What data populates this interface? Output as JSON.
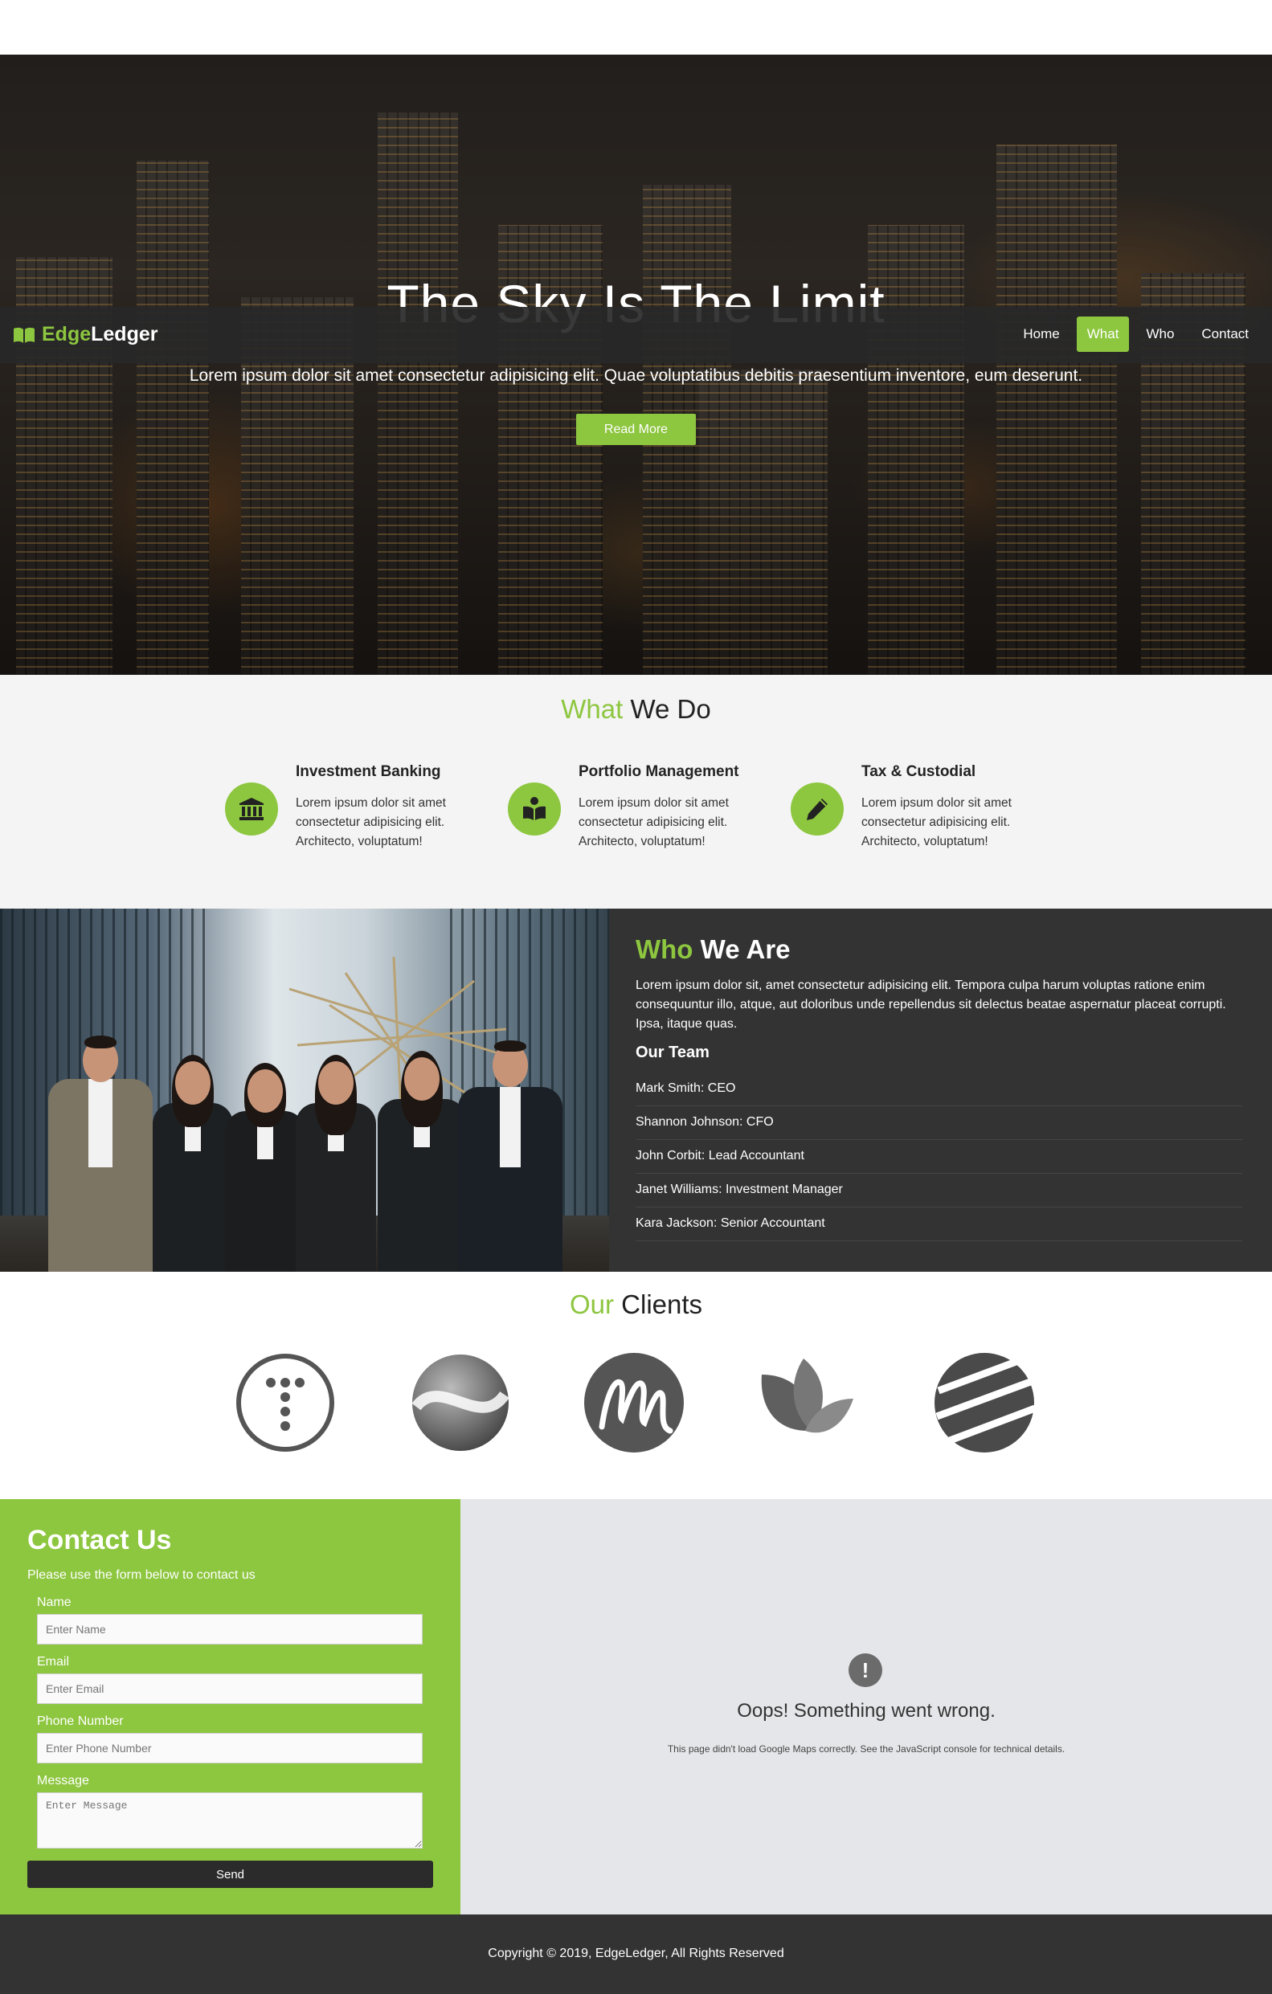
{
  "brand": {
    "part1": "Edge",
    "part2": "Ledger"
  },
  "nav": {
    "items": [
      {
        "label": "Home",
        "active": false
      },
      {
        "label": "What",
        "active": true
      },
      {
        "label": "Who",
        "active": false
      },
      {
        "label": "Contact",
        "active": false
      }
    ]
  },
  "hero": {
    "title": "The Sky Is The Limit",
    "subtitle": "Lorem ipsum dolor sit amet consectetur adipisicing elit. Quae voluptatibus debitis praesentium inventore, eum deserunt.",
    "button": "Read More"
  },
  "what": {
    "title_accent": "What",
    "title_rest": "We Do",
    "services": [
      {
        "icon": "bank-icon",
        "title": "Investment Banking",
        "text": "Lorem ipsum dolor sit amet consectetur adipisicing elit. Architecto, voluptatum!"
      },
      {
        "icon": "book-reader-icon",
        "title": "Portfolio Management",
        "text": "Lorem ipsum dolor sit amet consectetur adipisicing elit. Architecto, voluptatum!"
      },
      {
        "icon": "pencil-icon",
        "title": "Tax & Custodial",
        "text": "Lorem ipsum dolor sit amet consectetur adipisicing elit. Architecto, voluptatum!"
      }
    ]
  },
  "who": {
    "title_accent": "Who",
    "title_rest": "We Are",
    "text": "Lorem ipsum dolor sit, amet consectetur adipisicing elit. Tempora culpa harum voluptas ratione enim consequuntur illo, atque, aut doloribus unde repellendus sit delectus beatae aspernatur placeat corrupti. Ipsa, itaque quas.",
    "team_heading": "Our Team",
    "team": [
      "Mark Smith: CEO",
      "Shannon Johnson: CFO",
      "John Corbit: Lead Accountant",
      "Janet Williams: Investment Manager",
      "Kara Jackson: Senior Accountant"
    ]
  },
  "clients": {
    "title_accent": "Our",
    "title_rest": "Clients",
    "logos": [
      "t-circle-logo",
      "swirl-sphere-logo",
      "m-script-logo",
      "leaves-logo",
      "striped-globe-logo"
    ]
  },
  "contact": {
    "title": "Contact Us",
    "subtitle": "Please use the form below to contact us",
    "fields": {
      "name_label": "Name",
      "name_placeholder": "Enter Name",
      "email_label": "Email",
      "email_placeholder": "Enter Email",
      "phone_label": "Phone Number",
      "phone_placeholder": "Enter Phone Number",
      "message_label": "Message",
      "message_placeholder": "Enter Message"
    },
    "send": "Send"
  },
  "map": {
    "icon": "!",
    "title": "Oops! Something went wrong.",
    "text": "This page didn't load Google Maps correctly. See the JavaScript console for technical details."
  },
  "footer": {
    "text": "Copyright © 2019, EdgeLedger, All Rights Reserved"
  },
  "colors": {
    "accent": "#8dc63f",
    "dark": "#333333",
    "nav_bg": "#282828",
    "light_bg": "#f4f4f4"
  }
}
